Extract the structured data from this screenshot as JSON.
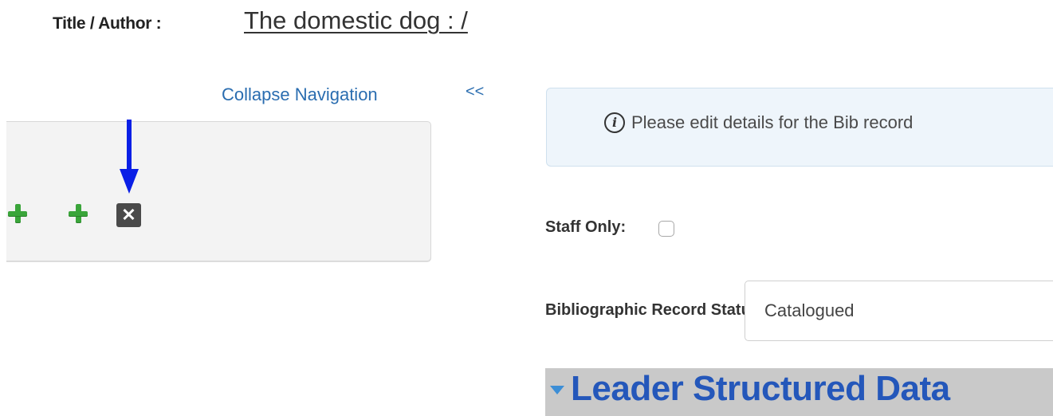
{
  "title_row": {
    "label": "Title / Author :",
    "value": "The domestic dog : /"
  },
  "navigation": {
    "collapse_label": "Collapse Navigation",
    "collapse_arrows": "<<",
    "icons": [
      "add-icon",
      "add-icon",
      "delete-icon"
    ]
  },
  "alert": {
    "icon": "info-icon",
    "text": "Please edit details for the Bib record"
  },
  "staff_only": {
    "label": "Staff Only:",
    "checked": false
  },
  "record_status": {
    "label": "Bibliographic Record Status:",
    "selected": "Catalogued"
  },
  "leader_section": {
    "title": "Leader Structured Data",
    "expanded": true
  },
  "colors": {
    "link": "#2a6db0",
    "add_icon": "#3aa53a",
    "delete_icon": "#4a4a4a",
    "annotation_arrow": "#0a1fe6",
    "alert_bg": "#eef5fb",
    "leader_bar": "#c9c9c9",
    "leader_title": "#2457ba"
  }
}
